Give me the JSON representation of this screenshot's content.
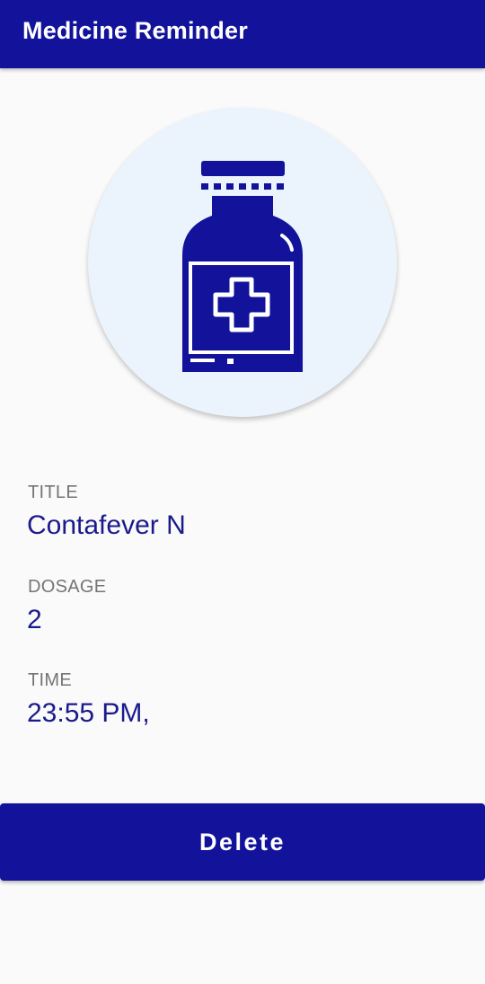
{
  "app_bar": {
    "title": "Medicine Reminder"
  },
  "header_image": {
    "icon": "medicine-bottle-icon",
    "icon_color": "#12139a",
    "circle_color": "#ebf3fc"
  },
  "details": {
    "title_label": "TITLE",
    "title_value": "Contafever N",
    "dosage_label": "DOSAGE",
    "dosage_value": "2",
    "time_label": "TIME",
    "time_value": "23:55 PM,"
  },
  "actions": {
    "delete_label": "Delete"
  },
  "colors": {
    "primary": "#12139a",
    "value_text": "#1a1a8c",
    "label_text": "#757575",
    "background": "#fafafa"
  }
}
